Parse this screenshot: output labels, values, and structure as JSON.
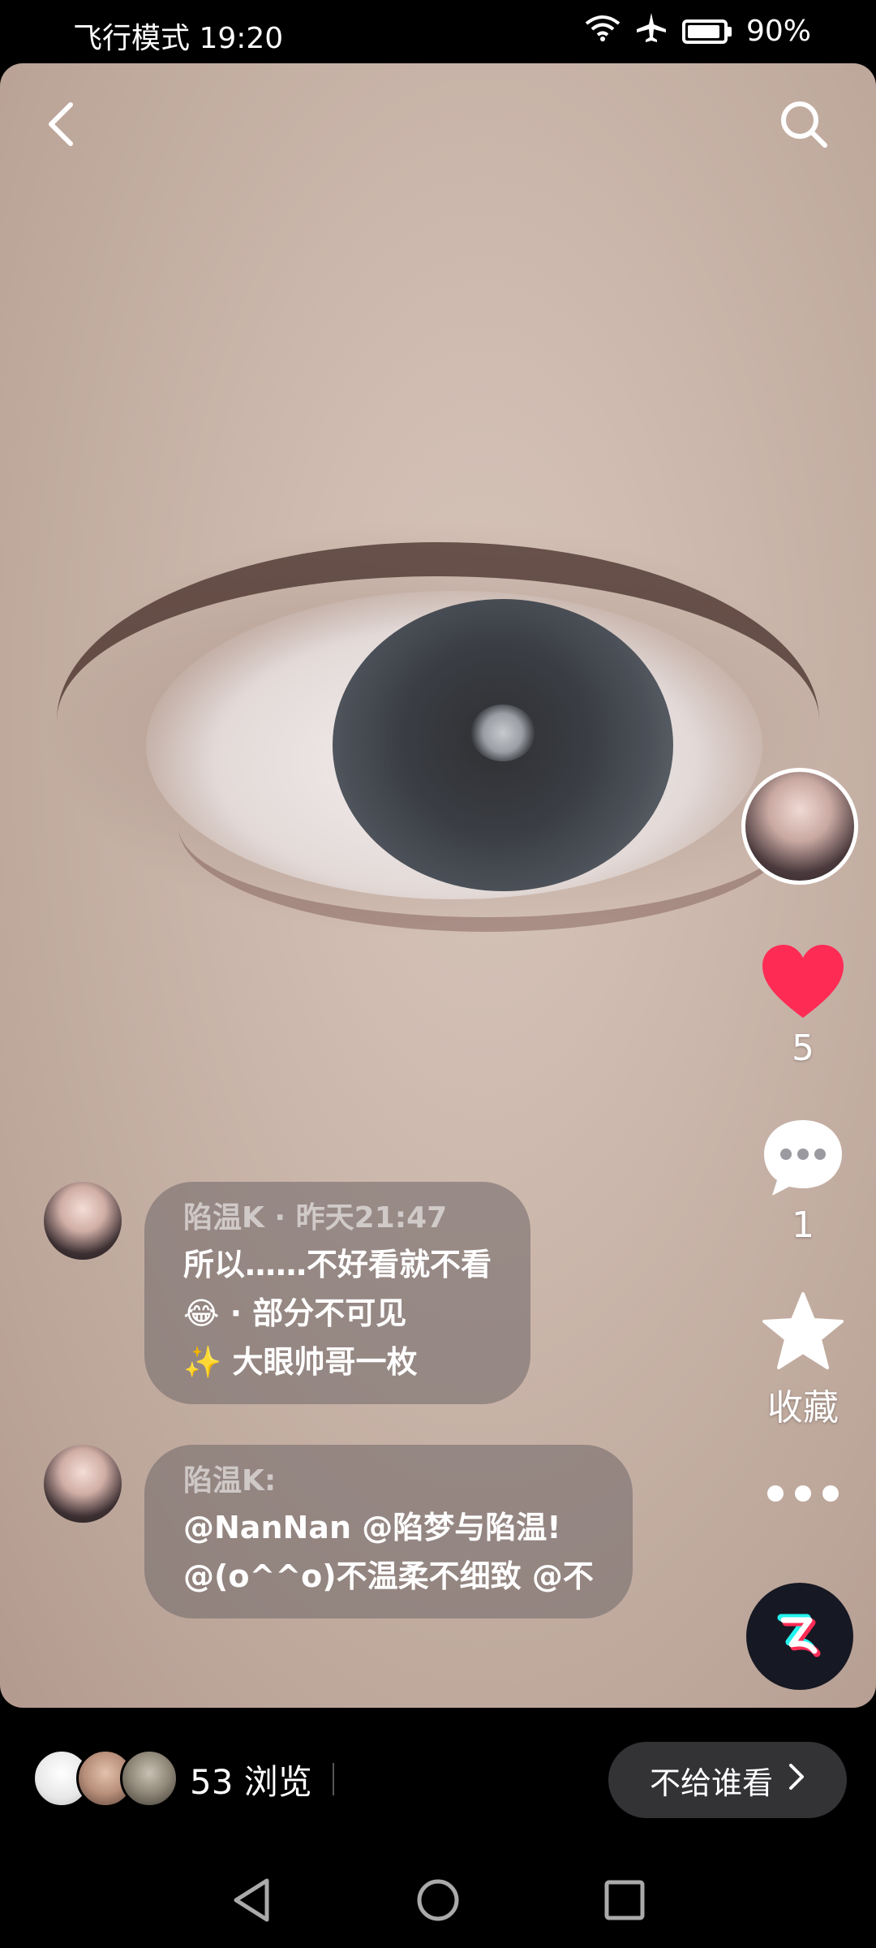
{
  "status_bar": {
    "mode_time": "飞行模式 19:20",
    "battery": "90%",
    "battery_level": 0.9
  },
  "header": {
    "back_icon": "chevron-left-icon",
    "search_icon": "search-icon"
  },
  "side_actions": {
    "like_count": "5",
    "comment_count": "1",
    "favorite_label": "收藏",
    "like_color": "#fe2c55"
  },
  "comments": [
    {
      "meta": "陷温K · 昨天21:47",
      "lines": [
        "所以……不好看就不看",
        "😂 · 部分不可见",
        "✨ 大眼帅哥一枚"
      ]
    },
    {
      "meta": "陷温K:",
      "lines": [
        "@NanNan @陷梦与陷温!",
        "@(o^^o)不温柔不细致 @不"
      ]
    }
  ],
  "footer": {
    "views": "53 浏览",
    "privacy_button": "不给谁看"
  }
}
